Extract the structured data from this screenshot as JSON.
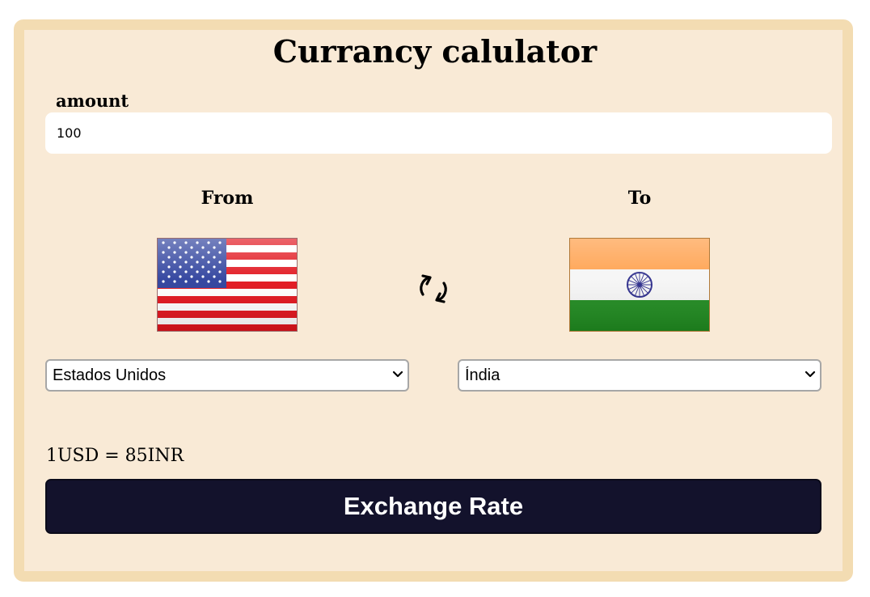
{
  "title": "Currancy calulator",
  "amount": {
    "label": "amount",
    "value": "100"
  },
  "from": {
    "label": "From",
    "flag_icon": "us-flag-icon",
    "selected": "Estados Unidos"
  },
  "to": {
    "label": "To",
    "flag_icon": "india-flag-icon",
    "selected": "Índia"
  },
  "swap_icon": "swap-arrows-icon",
  "result_text": "1USD = 85INR",
  "button_label": "Exchange Rate",
  "colors": {
    "card_bg": "#f9ead6",
    "card_border": "#f3dcb2",
    "button_bg": "#13122c",
    "button_text": "#ffffff"
  }
}
